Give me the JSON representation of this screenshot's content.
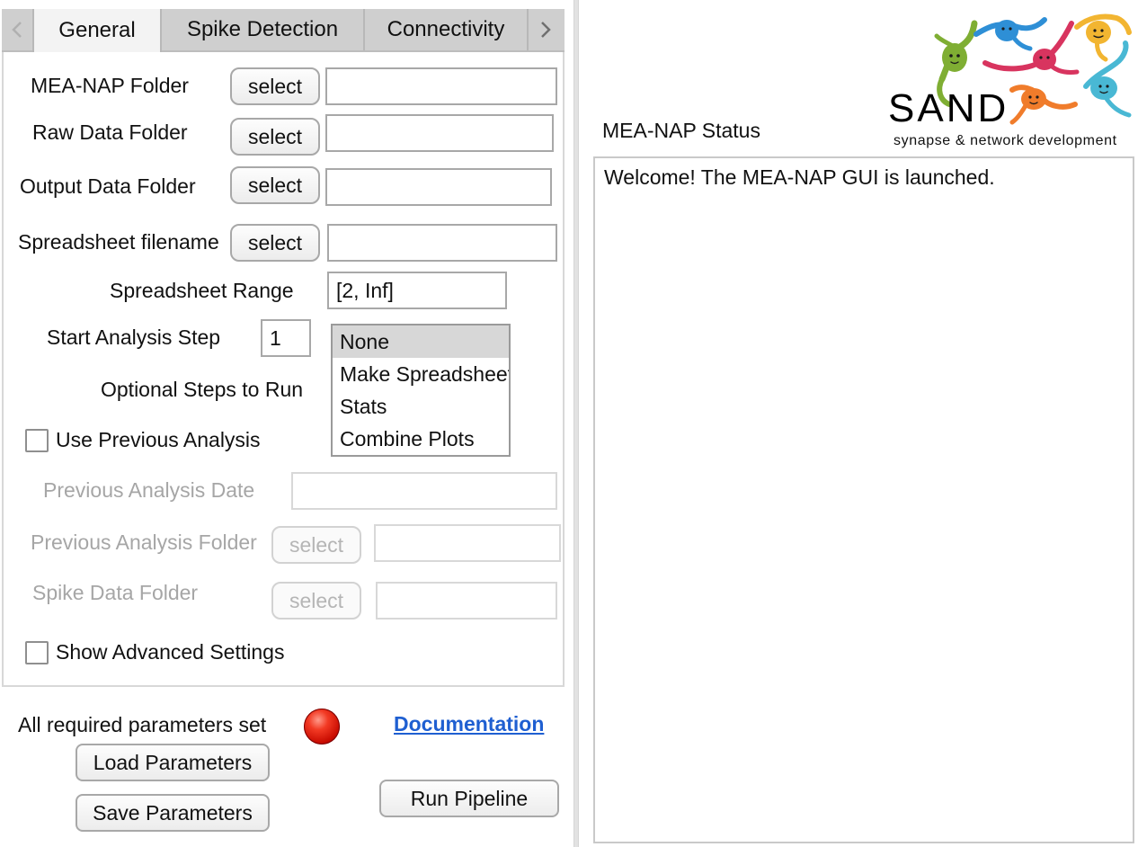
{
  "tabs": [
    {
      "label": "General",
      "active": true
    },
    {
      "label": "Spike Detection",
      "active": false
    },
    {
      "label": "Connectivity",
      "active": false
    }
  ],
  "general": {
    "mea_nap_folder": {
      "label": "MEA-NAP Folder",
      "button": "select",
      "value": ""
    },
    "raw_data_folder": {
      "label": "Raw Data Folder",
      "button": "select",
      "value": ""
    },
    "output_data_folder": {
      "label": "Output Data Folder",
      "button": "select",
      "value": ""
    },
    "spreadsheet_filename": {
      "label": "Spreadsheet filename",
      "button": "select",
      "value": ""
    },
    "spreadsheet_range": {
      "label": "Spreadsheet Range",
      "value": "[2, Inf]"
    },
    "start_analysis_step": {
      "label": "Start Analysis Step",
      "value": "1"
    },
    "optional_steps": {
      "label": "Optional Steps to Run",
      "options": [
        "None",
        "Make Spreadsheet",
        "Stats",
        "Combine Plots"
      ],
      "selected": "None"
    },
    "use_previous_analysis": {
      "label": "Use Previous Analysis",
      "checked": false
    },
    "previous_analysis_date": {
      "label": "Previous Analysis Date",
      "value": ""
    },
    "previous_analysis_folder": {
      "label": "Previous Analysis Folder",
      "button": "select",
      "value": ""
    },
    "spike_data_folder": {
      "label": "Spike Data Folder",
      "button": "select",
      "value": ""
    },
    "show_advanced_settings": {
      "label": "Show Advanced Settings",
      "checked": false
    }
  },
  "footer": {
    "status_label": "All required parameters set",
    "status_color": "#e0160c",
    "documentation_link": "Documentation",
    "load_button": "Load Parameters",
    "save_button": "Save Parameters",
    "run_button": "Run Pipeline"
  },
  "status_panel": {
    "title": "MEA-NAP Status",
    "message": "Welcome! The MEA-NAP GUI is launched."
  },
  "logo": {
    "wordmark": "SAND",
    "tagline": "synapse & network development",
    "colors": [
      "#7fae33",
      "#2e8fd6",
      "#d8345f",
      "#f2b531",
      "#f07c2b",
      "#49b8d4"
    ]
  }
}
